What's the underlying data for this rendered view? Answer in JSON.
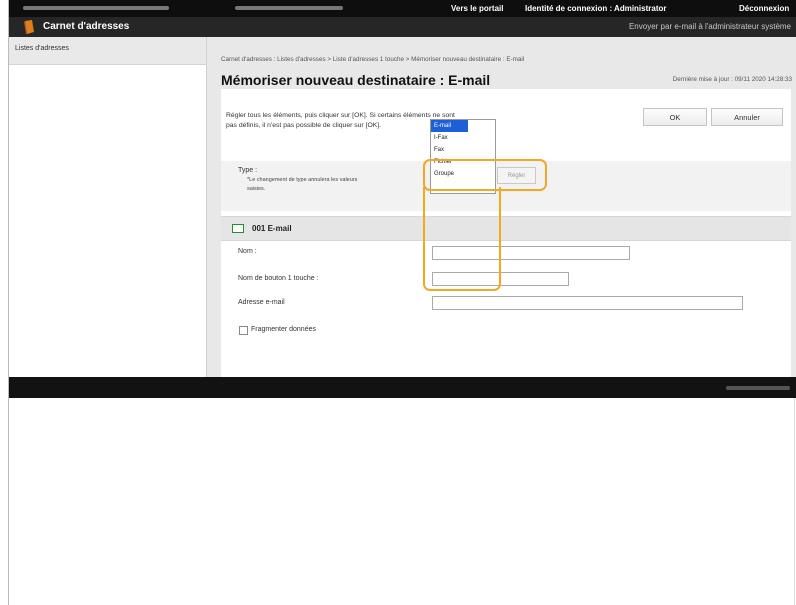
{
  "topbar": {
    "portal_link": "Vers le portail",
    "login_label": "Identité de connexion : Administrator",
    "logout_link": "Déconnexion"
  },
  "header": {
    "app_title": "Carnet d'adresses",
    "mail_admin_link": "Envoyer par e-mail à l'administrateur système"
  },
  "sidebar": {
    "items": [
      {
        "label": "Listes d'adresses"
      }
    ]
  },
  "breadcrumb": "Carnet d'adresses : Listes d'adresses > Liste d'adresses 1 touche > Mémoriser nouveau destinataire : E-mail",
  "page": {
    "title": "Mémoriser nouveau destinataire : E-mail",
    "last_update": "Dernière mise à jour : 09/11 2020 14:28:33",
    "instructions": "Régler tous les éléments, puis cliquer sur [OK]. Si certains éléments ne sont pas définis, il n'est pas possible de cliquer sur [OK].",
    "ok_label": "OK",
    "cancel_label": "Annuler"
  },
  "type_section": {
    "label": "Type :",
    "note": "*Le changement de type annulera les valeurs saisies.",
    "options": [
      "E-mail",
      "I-Fax",
      "Fax",
      "Fichier",
      "Groupe"
    ],
    "selected": "E-mail",
    "set_label": "Régler"
  },
  "entry": {
    "title": "001 E-mail",
    "fields": [
      {
        "label": "Nom :",
        "value": ""
      },
      {
        "label": "Nom de bouton 1 touche :",
        "value": ""
      },
      {
        "label": "Adresse e-mail",
        "value": ""
      }
    ],
    "split_data_label": "Fragmenter données",
    "split_data_checked": false
  },
  "colors": {
    "highlight": "#f3a724",
    "selection": "#1d5fd6",
    "header_bg": "#262626"
  }
}
